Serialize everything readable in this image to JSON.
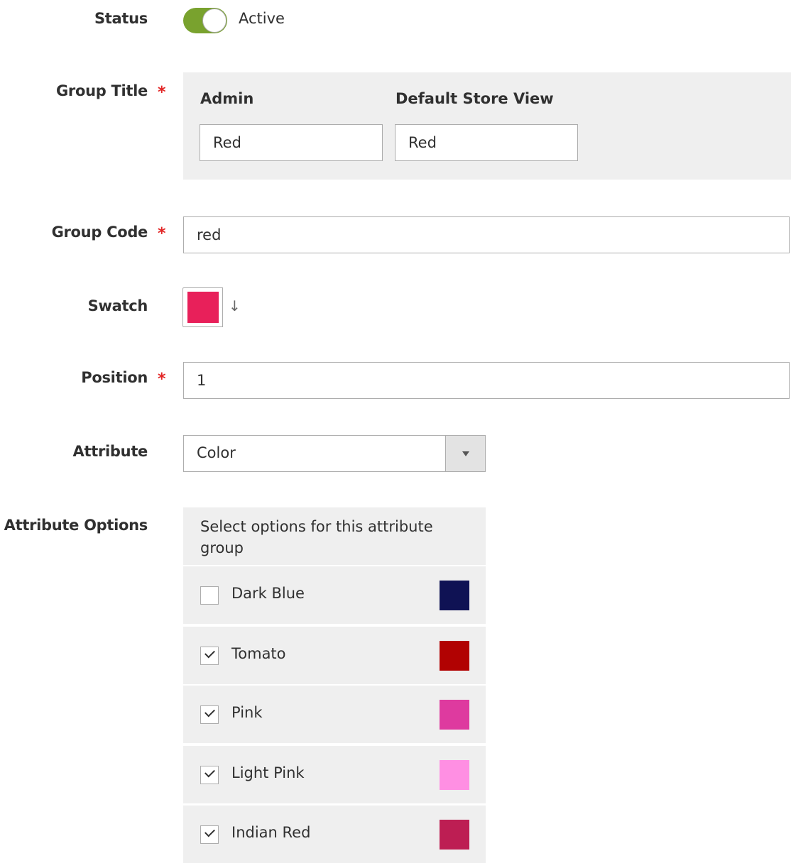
{
  "status": {
    "label": "Status",
    "value_text": "Active",
    "enabled": true,
    "track_color": "#79a22e"
  },
  "group_title": {
    "label": "Group Title",
    "required_mark": "*",
    "columns": [
      {
        "header": "Admin",
        "value": "Red"
      },
      {
        "header": "Default Store View",
        "value": "Red"
      }
    ]
  },
  "group_code": {
    "label": "Group Code",
    "required_mark": "*",
    "value": "red"
  },
  "swatch": {
    "label": "Swatch",
    "color": "#e8205a",
    "arrow_glyph": "↓"
  },
  "position": {
    "label": "Position",
    "required_mark": "*",
    "value": "1"
  },
  "attribute": {
    "label": "Attribute",
    "selected": "Color"
  },
  "attribute_options": {
    "label": "Attribute Options",
    "header": "Select options for this attribute group",
    "items": [
      {
        "label": "Dark Blue",
        "checked": false,
        "color": "#0f1254"
      },
      {
        "label": "Tomato",
        "checked": true,
        "color": "#b10202"
      },
      {
        "label": "Pink",
        "checked": true,
        "color": "#de3a9f"
      },
      {
        "label": "Light Pink",
        "checked": true,
        "color": "#ff8fe3"
      },
      {
        "label": "Indian Red",
        "checked": true,
        "color": "#bd1e53"
      }
    ]
  },
  "colors": {
    "required": "#e22626",
    "panel_bg": "#efefef",
    "border": "#adadad"
  }
}
